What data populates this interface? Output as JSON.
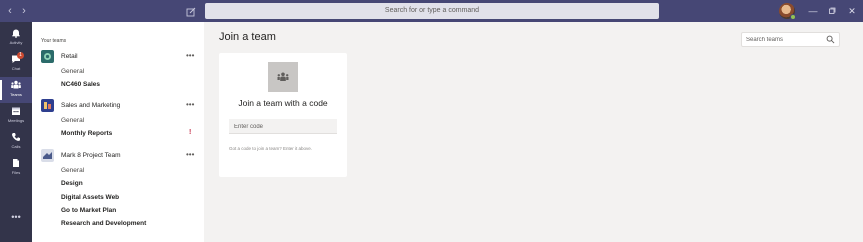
{
  "titlebar": {
    "back_icon": "chevron-left-icon",
    "forward_icon": "chevron-right-icon",
    "compose_icon": "compose-icon",
    "command_placeholder": "Search for or type a command",
    "window_controls": [
      "minimize-icon",
      "restore-icon",
      "close-icon"
    ]
  },
  "appbar": {
    "items": [
      {
        "label": "Activity",
        "icon": "bell-icon"
      },
      {
        "label": "Chat",
        "icon": "chat-icon",
        "badge": "1"
      },
      {
        "label": "Teams",
        "icon": "teams-icon",
        "active": true
      },
      {
        "label": "Meetings",
        "icon": "calendar-icon"
      },
      {
        "label": "Calls",
        "icon": "phone-icon"
      },
      {
        "label": "Files",
        "icon": "files-icon"
      }
    ],
    "more": "•••"
  },
  "teams_panel": {
    "heading": "Your teams",
    "more_label": "•••",
    "teams": [
      {
        "name": "Retail",
        "channels": [
          {
            "name": "General",
            "bold": false
          },
          {
            "name": "NC460 Sales",
            "bold": true
          }
        ]
      },
      {
        "name": "Sales and Marketing",
        "channels": [
          {
            "name": "General",
            "bold": false
          },
          {
            "name": "Monthly Reports",
            "bold": true,
            "alert": "!"
          }
        ]
      },
      {
        "name": "Mark 8 Project Team",
        "channels": [
          {
            "name": "General",
            "bold": false
          },
          {
            "name": "Design",
            "bold": true
          },
          {
            "name": "Digital Assets Web",
            "bold": true
          },
          {
            "name": "Go to Market Plan",
            "bold": true
          },
          {
            "name": "Research and Development",
            "bold": true
          }
        ]
      }
    ]
  },
  "main": {
    "title": "Join a team",
    "search_placeholder": "Search teams",
    "card": {
      "title": "Join a team with a code",
      "input_placeholder": "Enter code",
      "hint": "Got a code to join a team? Enter it above."
    }
  },
  "colors": {
    "titlebar": "#464775",
    "appbar": "#33344a",
    "accent": "#6264a7",
    "alert": "#c4314b",
    "badge": "#cc4a31"
  }
}
